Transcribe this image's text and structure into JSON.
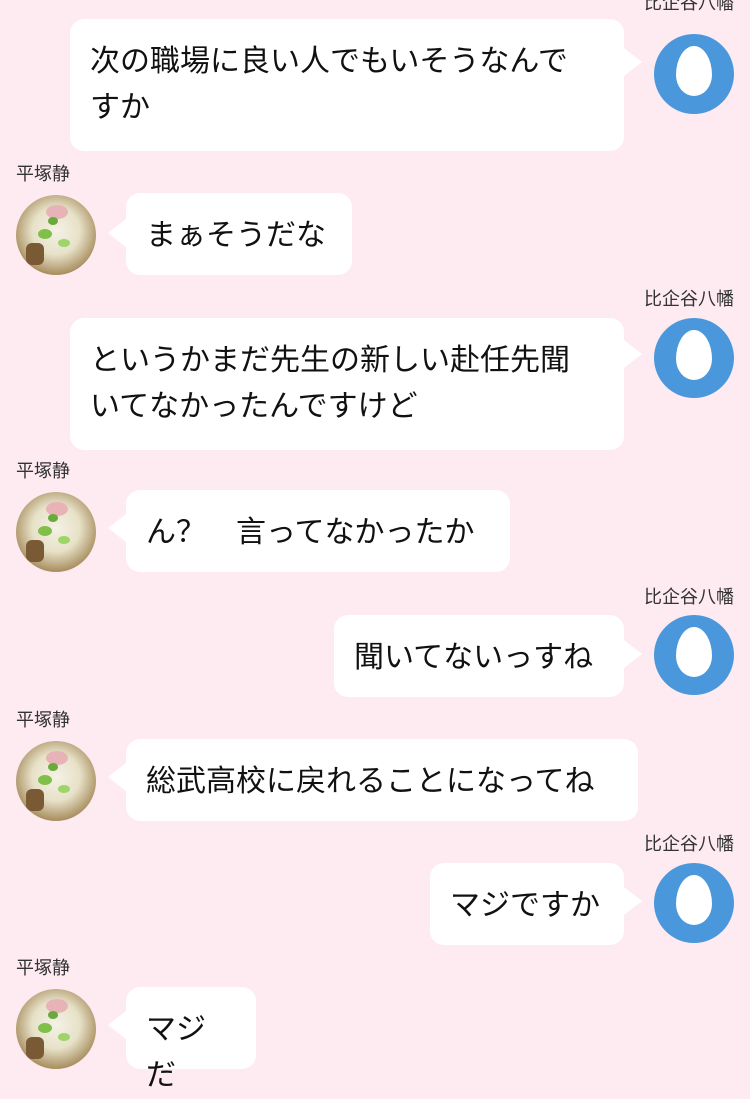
{
  "messages": [
    {
      "side": "right",
      "sender": "比企谷八幡",
      "text": "次の職場に良い人でもいそうなんで\nすか",
      "avatar": "egg-avatar-icon"
    },
    {
      "side": "left",
      "sender": "平塚静",
      "text": "まぁそうだな",
      "avatar": "ramen-photo-avatar"
    },
    {
      "side": "right",
      "sender": "比企谷八幡",
      "text": "というかまだ先生の新しい赴任先聞\nいてなかったんですけど",
      "avatar": "egg-avatar-icon"
    },
    {
      "side": "left",
      "sender": "平塚静",
      "text": "ん？　言ってなかったか",
      "avatar": "ramen-photo-avatar"
    },
    {
      "side": "right",
      "sender": "比企谷八幡",
      "text": "聞いてないっすね",
      "avatar": "egg-avatar-icon"
    },
    {
      "side": "left",
      "sender": "平塚静",
      "text": "総武高校に戻れることになってね",
      "avatar": "ramen-photo-avatar"
    },
    {
      "side": "right",
      "sender": "比企谷八幡",
      "text": "マジですか",
      "avatar": "egg-avatar-icon"
    },
    {
      "side": "left",
      "sender": "平塚静",
      "text": "マジだ",
      "avatar": "ramen-photo-avatar"
    }
  ],
  "colors": {
    "background": "#fdebf1",
    "bubble": "#ffffff",
    "egg_avatar": "#4a97dc"
  }
}
